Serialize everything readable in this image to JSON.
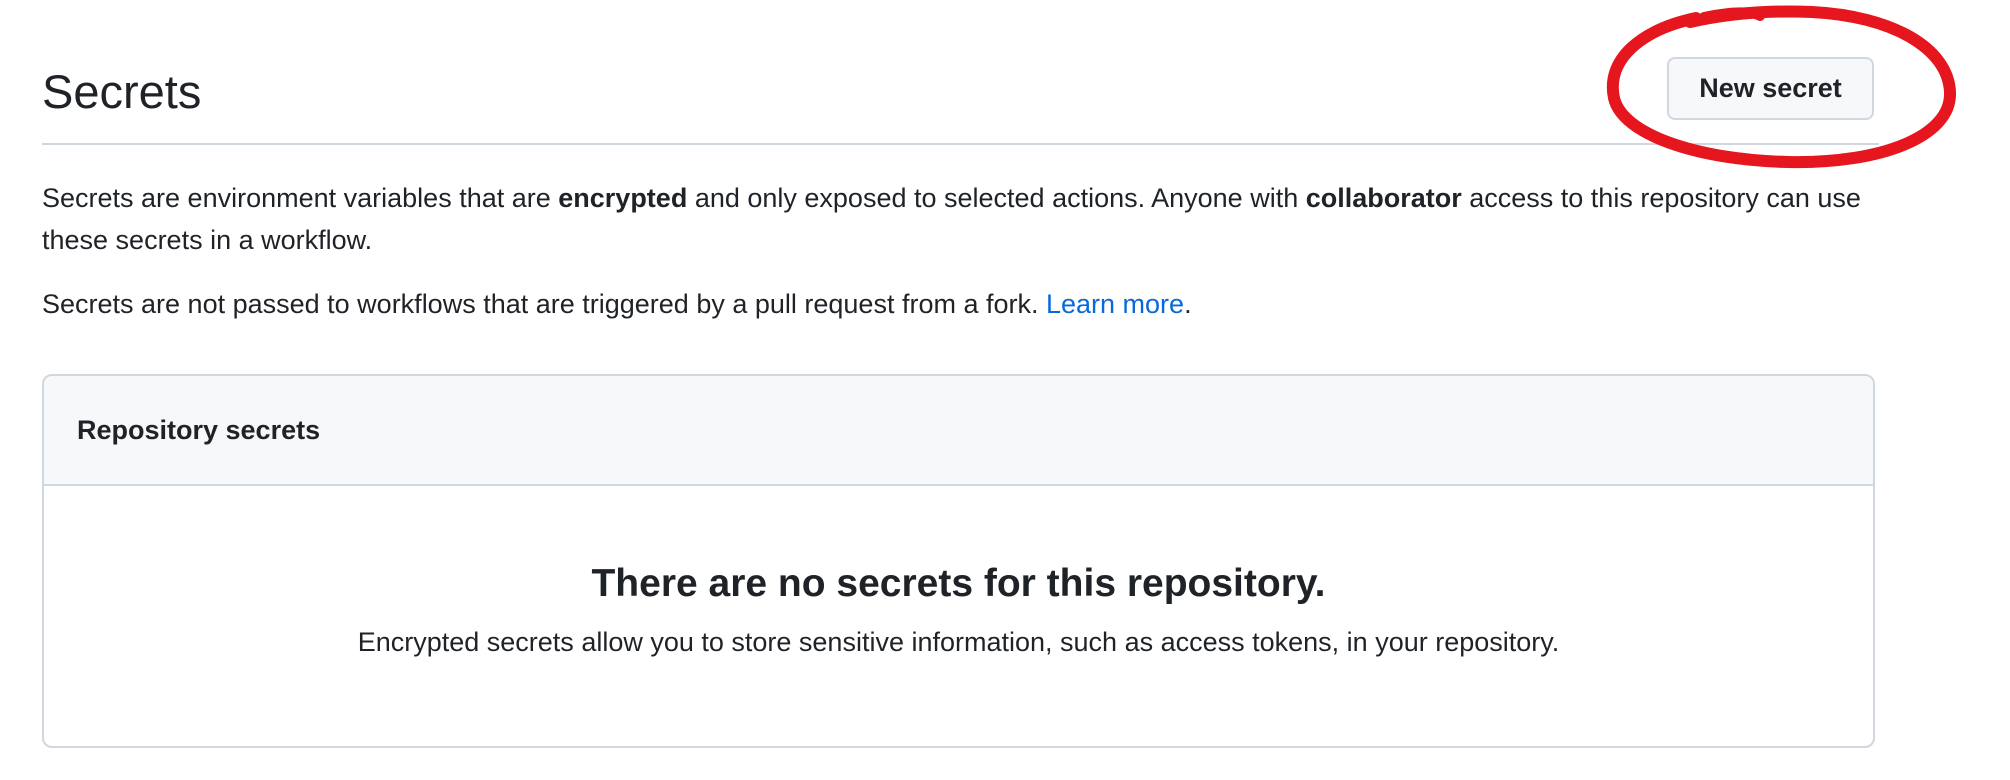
{
  "header": {
    "title": "Secrets",
    "new_secret_label": "New secret"
  },
  "description": {
    "p1_before_encrypted": "Secrets are environment variables that are ",
    "p1_encrypted": "encrypted",
    "p1_middle": " and only exposed to selected actions. Anyone with ",
    "p1_collaborator": "collaborator",
    "p1_after": " access to this repository can use these secrets in a workflow.",
    "p2_text": "Secrets are not passed to workflows that are triggered by a pull request from a fork. ",
    "p2_link": "Learn more",
    "p2_end": "."
  },
  "repository_secrets": {
    "header": "Repository secrets",
    "empty_title": "There are no secrets for this repository.",
    "empty_text": "Encrypted secrets allow you to store sensitive information, such as access tokens, in your repository."
  },
  "colors": {
    "link": "#0969da",
    "border": "#d0d7de",
    "box_header_bg": "#f6f8fa",
    "annotation": "#e5161d"
  }
}
